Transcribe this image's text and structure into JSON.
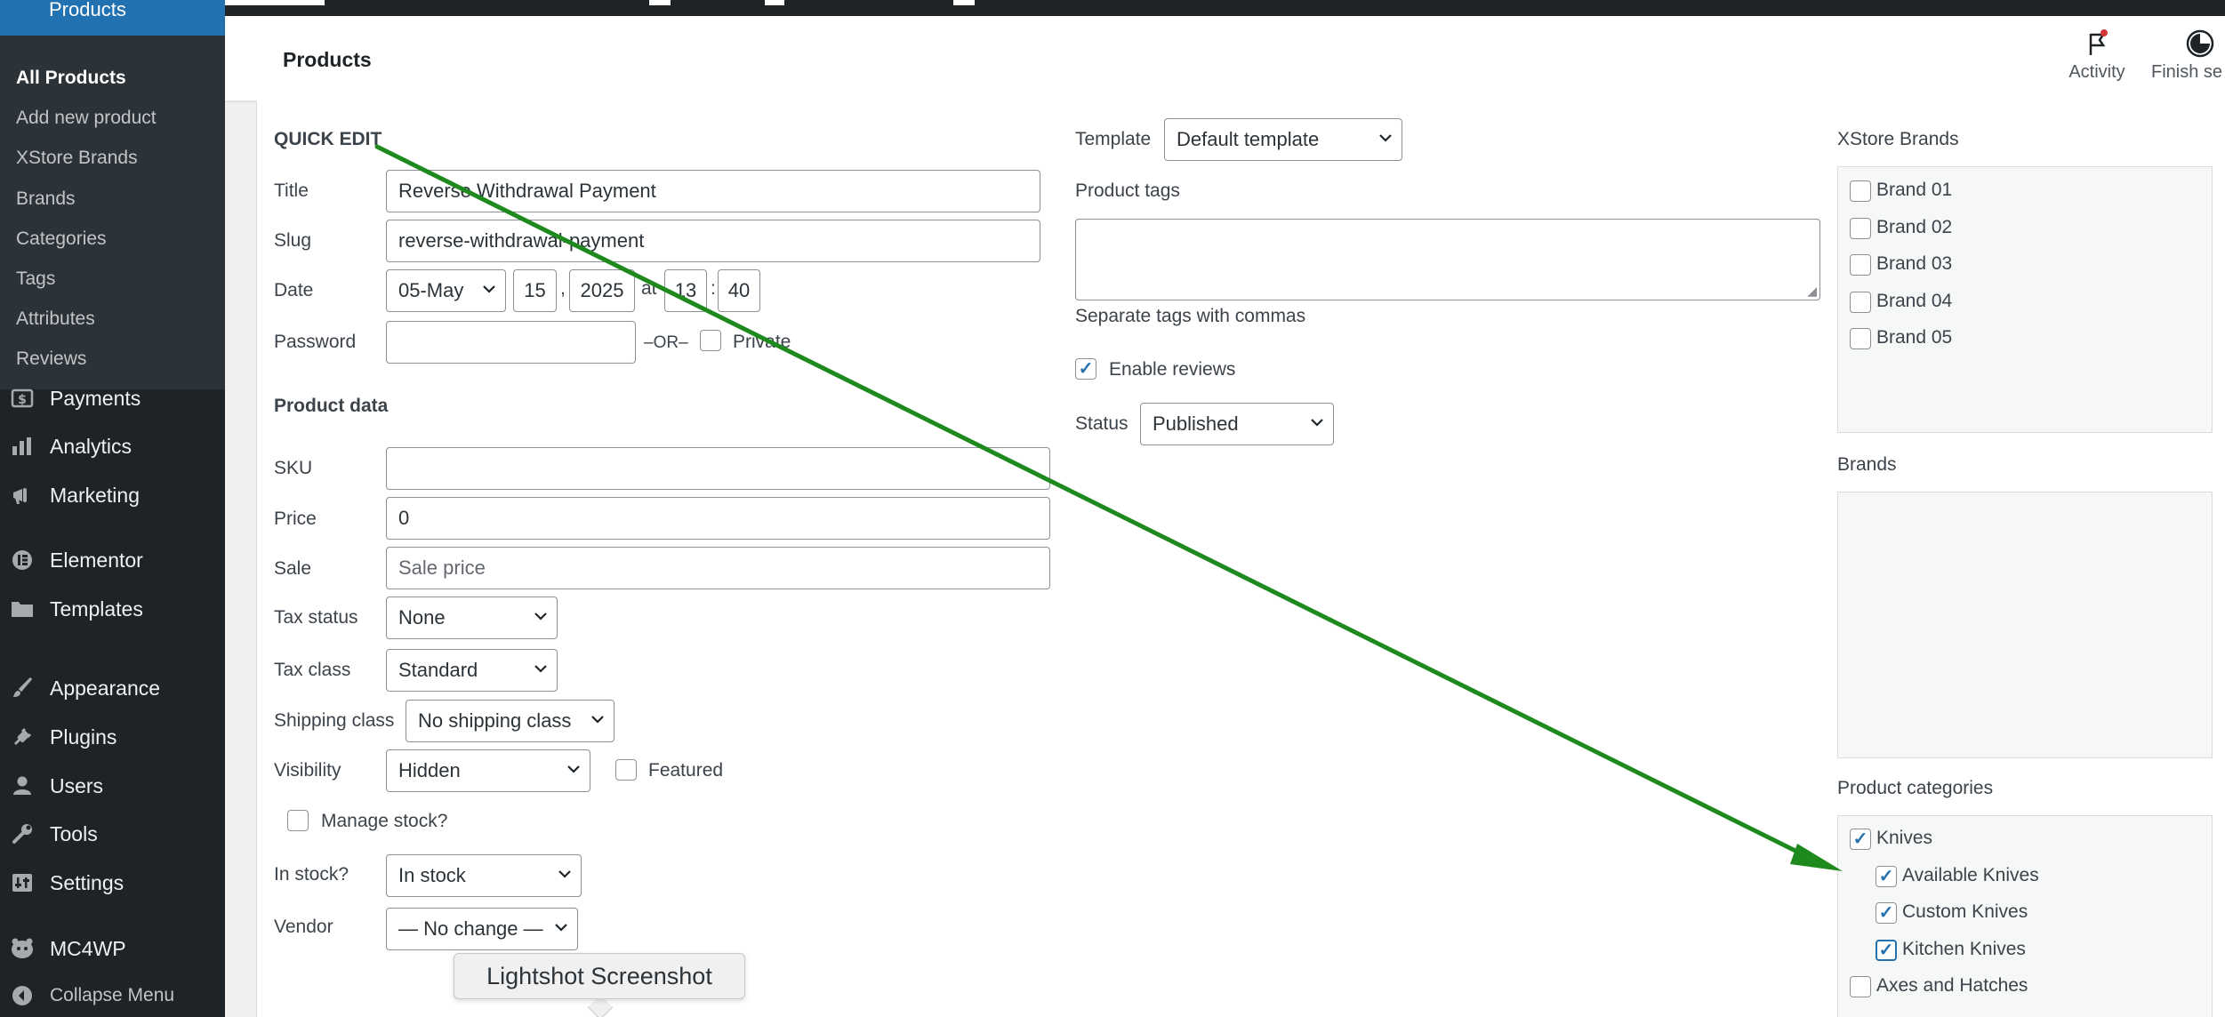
{
  "sidebar": {
    "current_section_label": "Products",
    "submenu": [
      "All Products",
      "Add new product",
      "XStore Brands",
      "Brands",
      "Categories",
      "Tags",
      "Attributes",
      "Reviews"
    ],
    "menu": [
      {
        "label": "Payments",
        "icon": "payments-icon"
      },
      {
        "label": "Analytics",
        "icon": "analytics-icon"
      },
      {
        "label": "Marketing",
        "icon": "megaphone-icon"
      },
      {
        "label": "Elementor",
        "icon": "elementor-icon"
      },
      {
        "label": "Templates",
        "icon": "folder-icon"
      },
      {
        "label": "Appearance",
        "icon": "brush-icon"
      },
      {
        "label": "Plugins",
        "icon": "plug-icon"
      },
      {
        "label": "Users",
        "icon": "user-icon"
      },
      {
        "label": "Tools",
        "icon": "wrench-icon"
      },
      {
        "label": "Settings",
        "icon": "settings-icon"
      },
      {
        "label": "MC4WP",
        "icon": "mc4wp-icon"
      },
      {
        "label": "Collapse Menu",
        "icon": "collapse-icon"
      }
    ]
  },
  "header": {
    "title": "Products",
    "activity_label": "Activity",
    "finish_label": "Finish se"
  },
  "quick_edit": {
    "heading": "QUICK EDIT",
    "title_label": "Title",
    "title_value": "Reverse Withdrawal Payment",
    "slug_label": "Slug",
    "slug_value": "reverse-withdrawal-payment",
    "date_label": "Date",
    "date_month": "05-May",
    "date_day": "15",
    "date_comma": ",",
    "date_year": "2025",
    "date_at": "at",
    "date_hour": "13",
    "date_colon": ":",
    "date_minute": "40",
    "password_label": "Password",
    "password_value": "",
    "or_label": "–OR–",
    "private_label": "Private"
  },
  "product_data": {
    "heading": "Product data",
    "sku_label": "SKU",
    "sku_value": "",
    "price_label": "Price",
    "price_value": "0",
    "sale_label": "Sale",
    "sale_placeholder": "Sale price",
    "tax_status_label": "Tax status",
    "tax_status_value": "None",
    "tax_class_label": "Tax class",
    "tax_class_value": "Standard",
    "shipping_class_label": "Shipping class",
    "shipping_class_value": "No shipping class",
    "visibility_label": "Visibility",
    "visibility_value": "Hidden",
    "featured_label": "Featured",
    "manage_stock_label": "Manage stock?",
    "in_stock_label": "In stock?",
    "in_stock_value": "In stock",
    "vendor_label": "Vendor",
    "vendor_value": "— No change —"
  },
  "middle": {
    "template_label": "Template",
    "template_value": "Default template",
    "tags_label": "Product tags",
    "tags_hint": "Separate tags with commas",
    "enable_reviews_label": "Enable reviews",
    "status_label": "Status",
    "status_value": "Published"
  },
  "right": {
    "xstore_brands_heading": "XStore Brands",
    "xstore_brands": [
      "Brand 01",
      "Brand 02",
      "Brand 03",
      "Brand 04",
      "Brand 05"
    ],
    "brands_heading": "Brands",
    "categories_heading": "Product categories",
    "categories": [
      {
        "label": "Knives",
        "checked": true,
        "child": false
      },
      {
        "label": "Available Knives",
        "checked": true,
        "child": true
      },
      {
        "label": "Custom Knives",
        "checked": true,
        "child": true
      },
      {
        "label": "Kitchen Knives",
        "checked": true,
        "child": true
      },
      {
        "label": "Axes and Hatches",
        "checked": false,
        "child": false
      }
    ]
  },
  "tooltip": {
    "text": "Lightshot Screenshot"
  },
  "colors": {
    "sidebar_bg": "#1d2327",
    "accent": "#2271b1",
    "annotation_arrow": "#1e8a1e"
  }
}
